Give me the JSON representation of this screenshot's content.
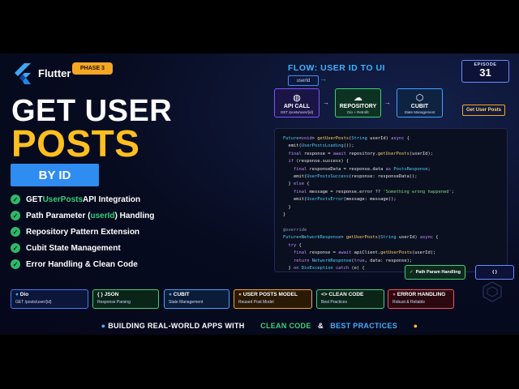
{
  "brand": {
    "name": "Flutter",
    "phase": "PHASE 3"
  },
  "title": {
    "line1": "GET USER",
    "line2": "POSTS",
    "badge": "BY ID"
  },
  "features": [
    {
      "pre": "GET ",
      "hl": "UserPosts",
      "post": " API Integration"
    },
    {
      "pre": "Path Parameter (",
      "hl": "userId",
      "post": ") Handling"
    },
    {
      "pre": "Repository Pattern Extension",
      "hl": "",
      "post": ""
    },
    {
      "pre": "Cubit State Management",
      "hl": "",
      "post": ""
    },
    {
      "pre": "Error Handling & Clean Code",
      "hl": "",
      "post": ""
    }
  ],
  "flow": {
    "title": "FLOW: USER ID TO UI",
    "input": "userId",
    "api": {
      "title": "API CALL",
      "sub": "GET /posts/user/{id}"
    },
    "repo": {
      "title": "REPOSITORY",
      "sub": "Dio + Retrofit"
    },
    "cubit": {
      "title": "CUBIT",
      "sub": "State Management"
    },
    "action": "Get User Posts"
  },
  "episode": {
    "label": "EPISODE",
    "number": "31"
  },
  "code_tags": {
    "path_param": "Path Param Handling",
    "braces": "{ }"
  },
  "cards": [
    {
      "title": "Dio",
      "desc": "GET /posts/user/{id}"
    },
    {
      "title": "{ } JSON",
      "desc": "Response Parsing"
    },
    {
      "title": "CUBIT",
      "desc": "State Management"
    },
    {
      "title": "USER POSTS MODEL",
      "desc": "Reused Post Model"
    },
    {
      "title": "<> CLEAN CODE",
      "desc": "Best Practices"
    },
    {
      "title": "ERROR HANDLING",
      "desc": "Robust & Reliable"
    }
  ],
  "footer": {
    "prefix": "BUILDING REAL-WORLD APPS WITH",
    "clean": "CLEAN CODE",
    "amp": "&",
    "best": "BEST PRACTICES"
  },
  "colors": {
    "accent_blue": "#2f8cf0",
    "accent_yellow": "#ffbf1f",
    "accent_green": "#3fd07a"
  }
}
